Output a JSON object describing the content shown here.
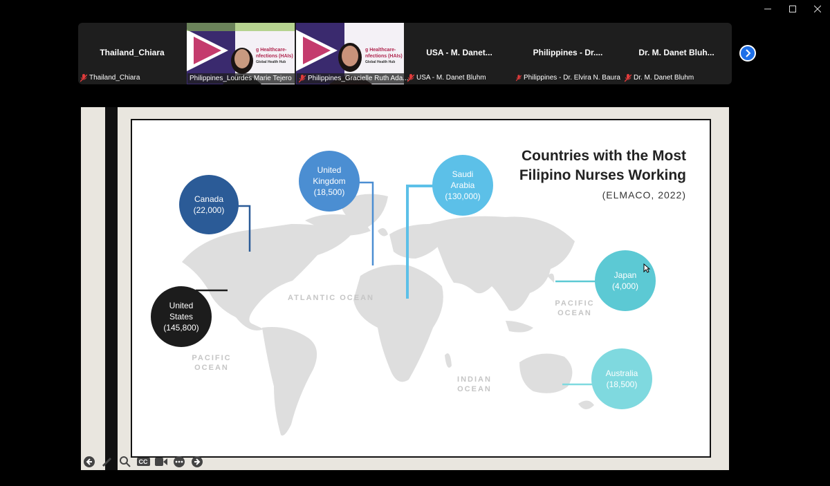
{
  "participants": [
    {
      "big_name": "Thailand_Chiara",
      "label": "Thailand_Chiara",
      "video": false
    },
    {
      "big_name": "",
      "label": "Philippines_Lourdes Marie Tejero",
      "video": true,
      "active": true
    },
    {
      "big_name": "",
      "label": "Philippines_Gracielle Ruth Ada...",
      "video": true
    },
    {
      "big_name": "USA - M. Danet...",
      "label": "USA - M. Danet Bluhm",
      "video": false
    },
    {
      "big_name": "Philippines - Dr....",
      "label": "Philippines - Dr. Elvira N. Baura",
      "video": false
    },
    {
      "big_name": "Dr. M. Danet Bluh...",
      "label": "Dr. M. Danet Bluhm",
      "video": false
    }
  ],
  "slide": {
    "title_line1": "Countries with the Most",
    "title_line2": "Filipino Nurses Working",
    "source": "(ELMACO, 2022)",
    "countries": [
      {
        "name": "Canada",
        "value": "(22,000)"
      },
      {
        "name": "United Kingdom",
        "value": "(18,500)"
      },
      {
        "name": "Saudi Arabia",
        "value": "(130,000)"
      },
      {
        "name": "United States",
        "value": "(145,800)"
      },
      {
        "name": "Japan",
        "value": "(4,000)"
      },
      {
        "name": "Australia",
        "value": "(18,500)"
      }
    ],
    "oceans": {
      "atlantic": "ATLANTIC OCEAN",
      "pacific_left": "PACIFIC OCEAN",
      "pacific_right": "PACIFIC OCEAN",
      "indian": "INDIAN OCEAN"
    },
    "colors": {
      "canada": "#2b5b97",
      "uk": "#4b8ed2",
      "saudi": "#5cc0e8",
      "usa": "#1c1c1c",
      "japan": "#5cc9d4",
      "australia": "#7fd9df"
    }
  },
  "video_slide_text": {
    "line1": "g Healthcare-",
    "line2": "nfections (HAIs)",
    "line3": "Global Health Hub"
  },
  "toolbar_icons": [
    "back-arrow-icon",
    "pen-icon",
    "zoom-icon",
    "captions-icon",
    "camera-icon",
    "more-icon",
    "forward-arrow-icon"
  ],
  "captions_text": "CC"
}
